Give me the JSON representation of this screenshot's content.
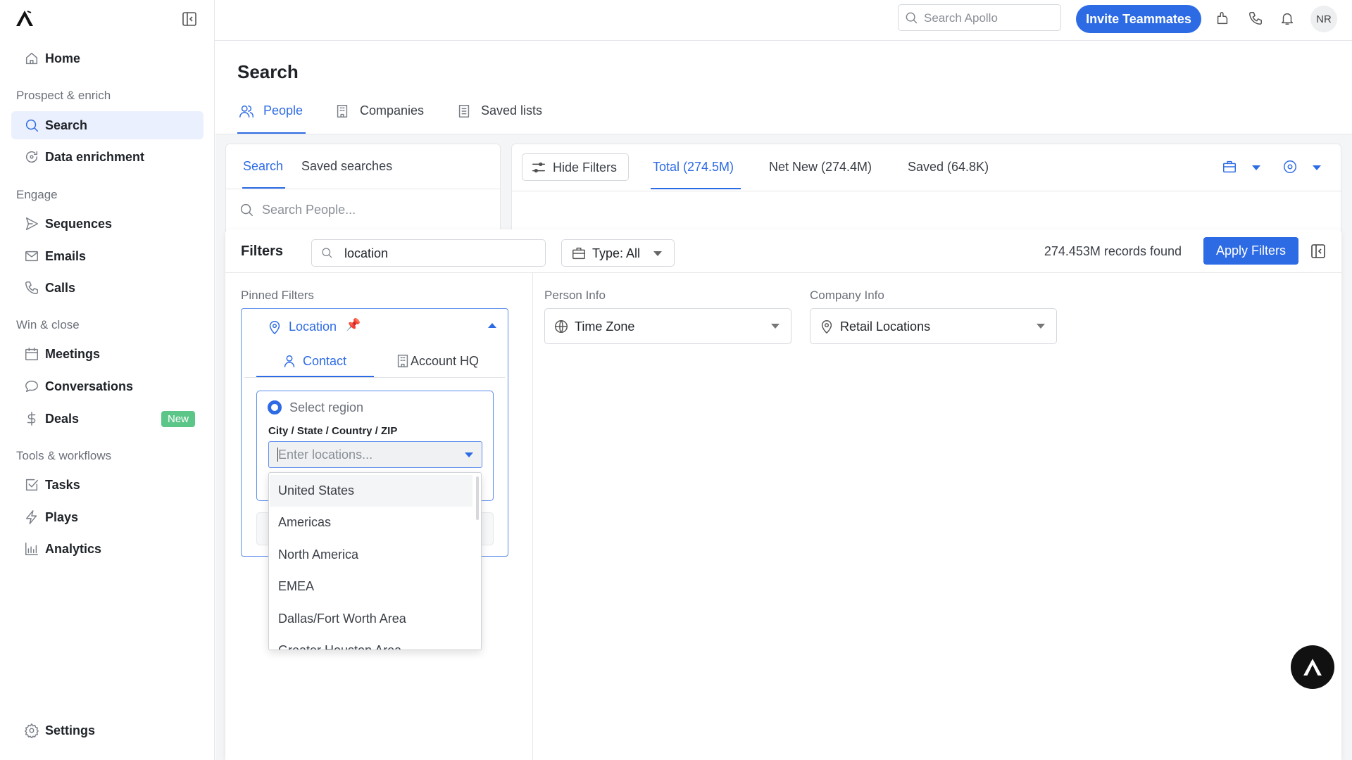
{
  "sidebar": {
    "sections": [
      "Prospect & enrich",
      "Engage",
      "Win & close",
      "Tools & workflows"
    ],
    "items": [
      {
        "label": "Home",
        "icon": "home-icon"
      },
      {
        "label": "Search",
        "icon": "search-icon",
        "active": true
      },
      {
        "label": "Data enrichment",
        "icon": "refresh-icon"
      },
      {
        "label": "Sequences",
        "icon": "send-icon"
      },
      {
        "label": "Emails",
        "icon": "mail-icon"
      },
      {
        "label": "Calls",
        "icon": "phone-icon"
      },
      {
        "label": "Meetings",
        "icon": "calendar-icon"
      },
      {
        "label": "Conversations",
        "icon": "chat-icon"
      },
      {
        "label": "Deals",
        "icon": "dollar-icon",
        "badge": "New"
      },
      {
        "label": "Tasks",
        "icon": "checkbox-icon"
      },
      {
        "label": "Plays",
        "icon": "bolt-icon"
      },
      {
        "label": "Analytics",
        "icon": "bar-chart-icon"
      },
      {
        "label": "Settings",
        "icon": "gear-icon"
      }
    ]
  },
  "topbar": {
    "search_placeholder": "Search Apollo",
    "invite_label": "Invite Teammates",
    "avatar_initials": "NR"
  },
  "page": {
    "title": "Search",
    "tabs": [
      "People",
      "Companies",
      "Saved lists"
    ],
    "active_tab": "People"
  },
  "left_panel": {
    "tabs": [
      "Search",
      "Saved searches"
    ],
    "search_placeholder": "Search People..."
  },
  "results": {
    "hide_filters": "Hide Filters",
    "tabs": [
      "Total (274.5M)",
      "Net New (274.4M)",
      "Saved (64.8K)"
    ]
  },
  "filters": {
    "title": "Filters",
    "search_value": "location",
    "type_label": "Type: All",
    "records": "274.453M records found",
    "apply_label": "Apply Filters",
    "pinned_label": "Pinned Filters",
    "location": {
      "label": "Location",
      "tabs": [
        "Contact",
        "Account HQ"
      ],
      "radio_label": "Select region",
      "field_label": "City / State / Country / ZIP",
      "input_placeholder": "Enter locations...",
      "options": [
        "United States",
        "Americas",
        "North America",
        "EMEA",
        "Dallas/Fort Worth Area",
        "Greater Houston Area"
      ]
    },
    "person_info": {
      "label": "Person Info",
      "select": "Time Zone"
    },
    "company_info": {
      "label": "Company Info",
      "select": "Retail Locations"
    }
  },
  "colors": {
    "accent": "#2d6be4",
    "badge": "#5cc689",
    "active_bg": "#eaf0fd"
  }
}
